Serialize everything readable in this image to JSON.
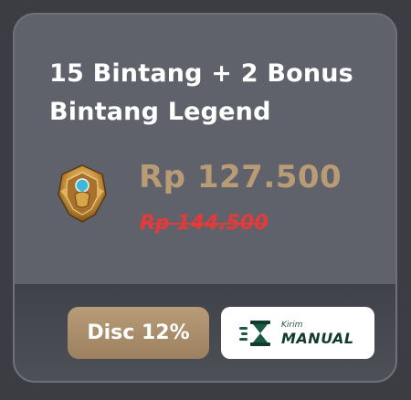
{
  "product": {
    "title": "15 Bintang + 2 Bonus Bintang Legend",
    "icon": "legend-rank-icon",
    "price": "Rp 127.500",
    "original_price": "Rp 144.500"
  },
  "badges": {
    "discount_label": "Disc 12%",
    "delivery_small": "Kirim",
    "delivery_big": "MANUAL",
    "delivery_icon": "hourglass-icon"
  },
  "colors": {
    "background": "#3b3d42",
    "card": "#5d6069",
    "price": "#b99b75",
    "strikethrough_price": "#e33a3a",
    "discount_badge": "#a88b69",
    "delivery_text": "#123b2e"
  }
}
